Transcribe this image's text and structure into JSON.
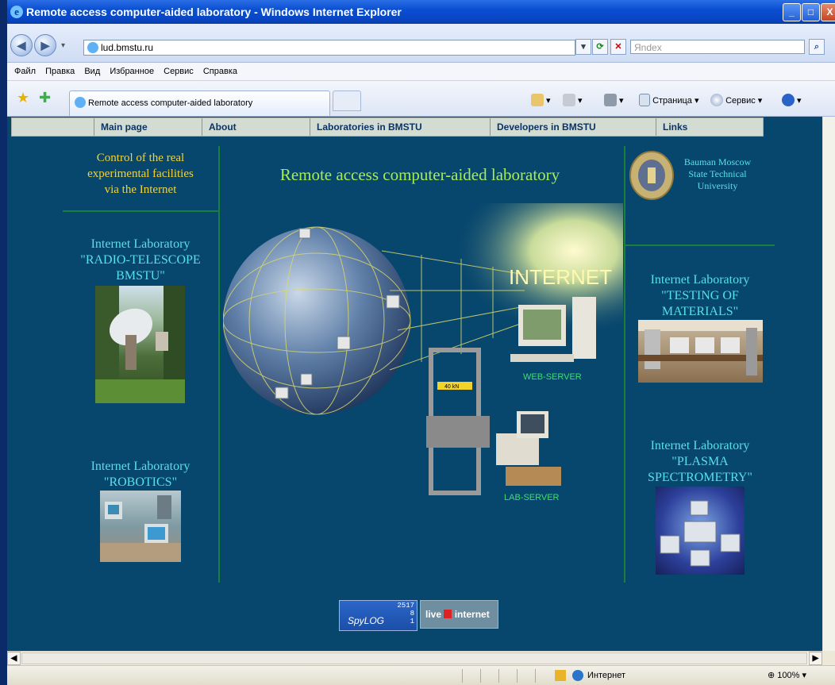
{
  "window": {
    "title": "Remote access computer-aided laboratory - Windows Internet Explorer",
    "minimize": "_",
    "maximize": "□",
    "close": "X"
  },
  "address_bar": {
    "url": "lud.bmstu.ru",
    "search_placeholder": "Яndex"
  },
  "menu": [
    "Файл",
    "Правка",
    "Вид",
    "Избранное",
    "Сервис",
    "Справка"
  ],
  "tab": {
    "title": "Remote access computer-aided laboratory"
  },
  "command_bar": {
    "page_label": "Страница",
    "tools_label": "Сервис"
  },
  "site_nav": [
    "Main page",
    "About",
    "Laboratories in BMSTU",
    "Developers in BMSTU",
    "Links"
  ],
  "left": {
    "intro": [
      "Control of the real",
      "experimental facilities",
      "via the Internet"
    ],
    "lab1": [
      "Internet Laboratory",
      "\"RADIO-TELESCOPE",
      "BMSTU\""
    ],
    "lab2": [
      "Internet Laboratory",
      "\"ROBOTICS\""
    ]
  },
  "center": {
    "title": "Remote access computer-aided laboratory",
    "internet_label": "INTERNET",
    "web_server": "WEB-SERVER",
    "lab_server": "LAB-SERVER",
    "machine_label": "40 kN"
  },
  "right": {
    "university": [
      "Bauman Moscow",
      "State Technical",
      "University"
    ],
    "lab3": [
      "Internet Laboratory",
      "\"TESTING OF",
      "MATERIALS\""
    ],
    "lab4": [
      "Internet Laboratory",
      "\"PLASMA",
      "SPECTROMETRY\""
    ]
  },
  "counters": {
    "spylog_values": [
      "2517",
      "8",
      "1"
    ],
    "spylog_label": "SpyLOG",
    "liveinternet_label": "live",
    "liveinternet_label2": "internet"
  },
  "status_bar": {
    "zone": "Интернет",
    "zoom": "100%"
  },
  "colors": {
    "page_bg": "#07466d",
    "accent_green": "#1a7f3a",
    "cyan_text": "#58e0e8",
    "yellow_text": "#f2d33a"
  }
}
